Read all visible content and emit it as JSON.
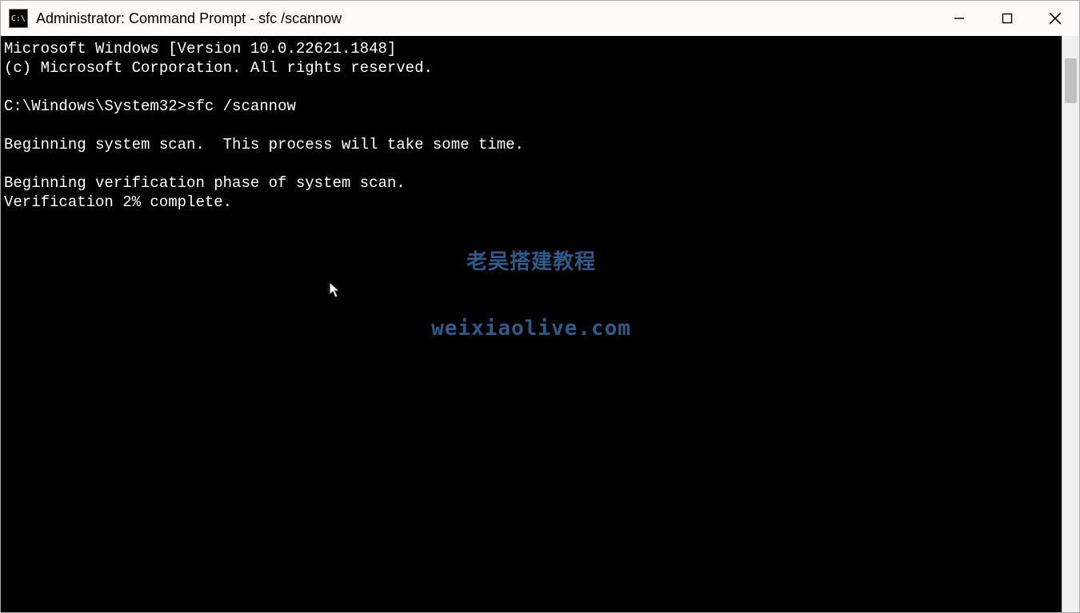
{
  "window": {
    "title": "Administrator: Command Prompt - sfc  /scannow",
    "app_icon_label": "C:\\"
  },
  "controls": {
    "minimize_tooltip": "Minimize",
    "maximize_tooltip": "Maximize",
    "close_tooltip": "Close"
  },
  "terminal": {
    "line_version": "Microsoft Windows [Version 10.0.22621.1848]",
    "line_copyright": "(c) Microsoft Corporation. All rights reserved.",
    "blank1": "",
    "prompt_path": "C:\\Windows\\System32>",
    "command": "sfc /scannow",
    "blank2": "",
    "line_begin_scan": "Beginning system scan.  This process will take some time.",
    "blank3": "",
    "line_verify_phase": "Beginning verification phase of system scan.",
    "line_verify_pct": "Verification 2% complete."
  },
  "watermark": {
    "line1": "老吴搭建教程",
    "line2": "weixiaolive.com"
  }
}
